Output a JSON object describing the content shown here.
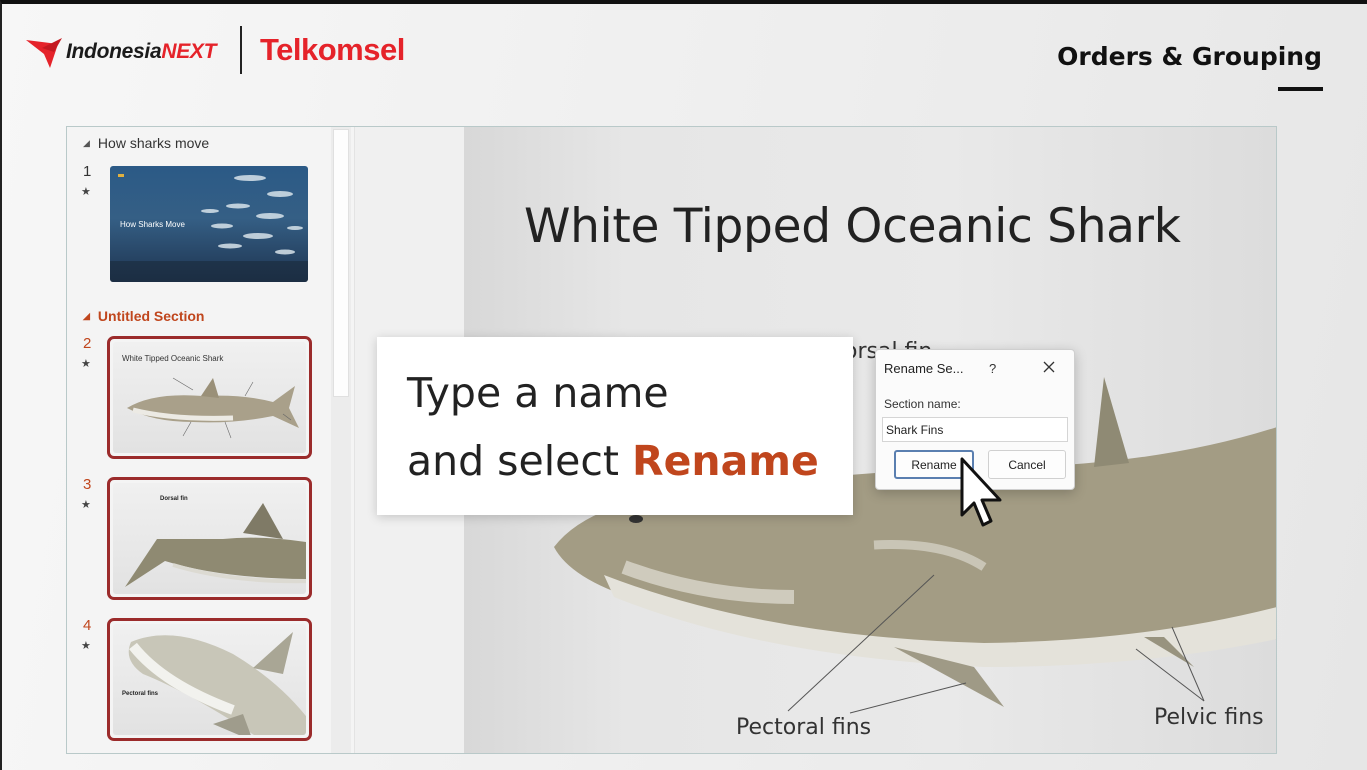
{
  "header": {
    "brand_left": "Indonesia",
    "brand_next": "NEXT",
    "brand_right": "Telkomsel",
    "title": "Orders & Grouping"
  },
  "thumbnails": {
    "sections": [
      {
        "name": "How sharks move",
        "state": "expanded"
      },
      {
        "name": "Untitled Section",
        "state": "selected"
      }
    ],
    "slides": [
      {
        "number": "1",
        "title": "How Sharks Move",
        "starred": true
      },
      {
        "number": "2",
        "title": "White Tipped Oceanic Shark",
        "starred": true,
        "selected": true
      },
      {
        "number": "3",
        "title": "Dorsal fin",
        "starred": true,
        "selected": true
      },
      {
        "number": "4",
        "title": "Pectoral fins",
        "starred": true,
        "selected": true
      }
    ]
  },
  "slide": {
    "title": "White Tipped Oceanic Shark",
    "labels": {
      "dorsal": "orsal fin",
      "pectoral": "Pectoral fins",
      "pelvic": "Pelvic fins"
    }
  },
  "callout": {
    "line1": "Type a name",
    "line2_prefix": "and select ",
    "line2_accent": "Rename"
  },
  "dialog": {
    "title": "Rename Se...",
    "help": "?",
    "field_label": "Section name:",
    "field_value": "Shark Fins",
    "rename_label": "Rename",
    "cancel_label": "Cancel"
  },
  "colors": {
    "accent": "#c0461d",
    "brand_red": "#e5232a",
    "selection_border": "#9b2b2b"
  }
}
